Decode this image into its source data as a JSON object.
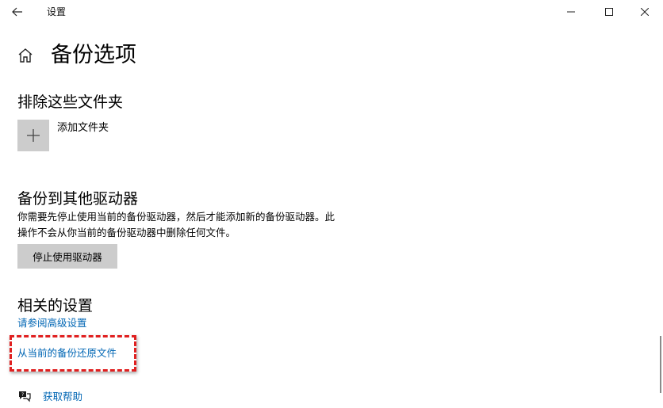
{
  "window": {
    "title": "设置"
  },
  "page": {
    "title": "备份选项"
  },
  "exclude_section": {
    "heading": "排除这些文件夹",
    "add_label": "添加文件夹"
  },
  "other_drive_section": {
    "heading": "备份到其他驱动器",
    "description_line1": "你需要先停止使用当前的备份驱动器，然后才能添加新的备份驱动器。此",
    "description_line2": "操作不会从你当前的备份驱动器中删除任何文件。",
    "stop_button": "停止使用驱动器"
  },
  "related_section": {
    "heading": "相关的设置",
    "advanced_link": "请参阅高级设置",
    "restore_link": "从当前的备份还原文件"
  },
  "help": {
    "label": "获取帮助"
  },
  "icons": {
    "back": "back-arrow-icon",
    "minimize": "minimize-icon",
    "maximize": "maximize-icon",
    "close": "close-icon",
    "home": "home-icon",
    "add": "plus-icon",
    "help": "help-chat-icon"
  },
  "colors": {
    "link": "#0066b4",
    "tile": "#cccccc",
    "highlight": "#e02020"
  }
}
